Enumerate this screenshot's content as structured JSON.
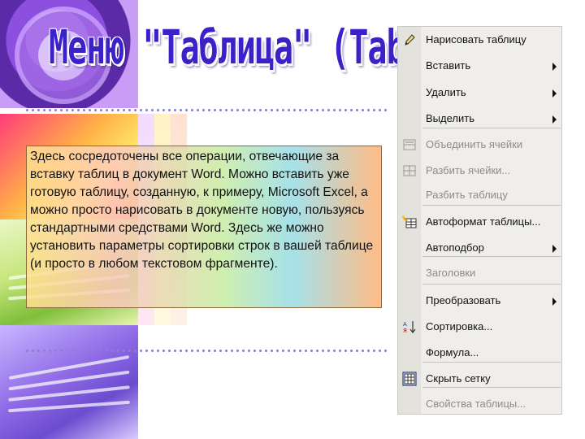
{
  "slide": {
    "title": "Меню \"Таблица\" (Table)",
    "description": "Здесь сосредоточены все операции, отвечающие за вставку таблиц в документ Word. Можно вставить уже готовую таблицу, созданную, к примеру, Microsoft Excel, а можно просто нарисовать в документе новую, пользуясь стандартными средствами Word. Здесь же можно установить параметры сортировки строк в вашей таблице (и просто в любом текстовом фрагменте)."
  },
  "menu": {
    "items": [
      {
        "label": "Нарисовать таблицу",
        "icon": "pencil-icon",
        "disabled": false,
        "submenu": false
      },
      {
        "label": "Вставить",
        "icon": "",
        "disabled": false,
        "submenu": true
      },
      {
        "label": "Удалить",
        "icon": "",
        "disabled": false,
        "submenu": true
      },
      {
        "label": "Выделить",
        "icon": "",
        "disabled": false,
        "submenu": true
      },
      {
        "label": "Объединить ячейки",
        "icon": "merge-cells-icon",
        "disabled": true,
        "submenu": false
      },
      {
        "label": "Разбить ячейки...",
        "icon": "split-cells-icon",
        "disabled": true,
        "submenu": false
      },
      {
        "label": "Разбить таблицу",
        "icon": "",
        "disabled": true,
        "submenu": false
      },
      {
        "label": "Автоформат таблицы...",
        "icon": "table-autoformat-icon",
        "disabled": false,
        "submenu": false
      },
      {
        "label": "Автоподбор",
        "icon": "",
        "disabled": false,
        "submenu": true
      },
      {
        "label": "Заголовки",
        "icon": "",
        "disabled": true,
        "submenu": false
      },
      {
        "label": "Преобразовать",
        "icon": "",
        "disabled": false,
        "submenu": true
      },
      {
        "label": "Сортировка...",
        "icon": "sort-icon",
        "disabled": false,
        "submenu": false
      },
      {
        "label": "Формула...",
        "icon": "",
        "disabled": false,
        "submenu": false
      },
      {
        "label": "Скрыть сетку",
        "icon": "grid-icon",
        "disabled": false,
        "submenu": false
      },
      {
        "label": "Свойства таблицы...",
        "icon": "",
        "disabled": true,
        "submenu": false
      }
    ]
  }
}
